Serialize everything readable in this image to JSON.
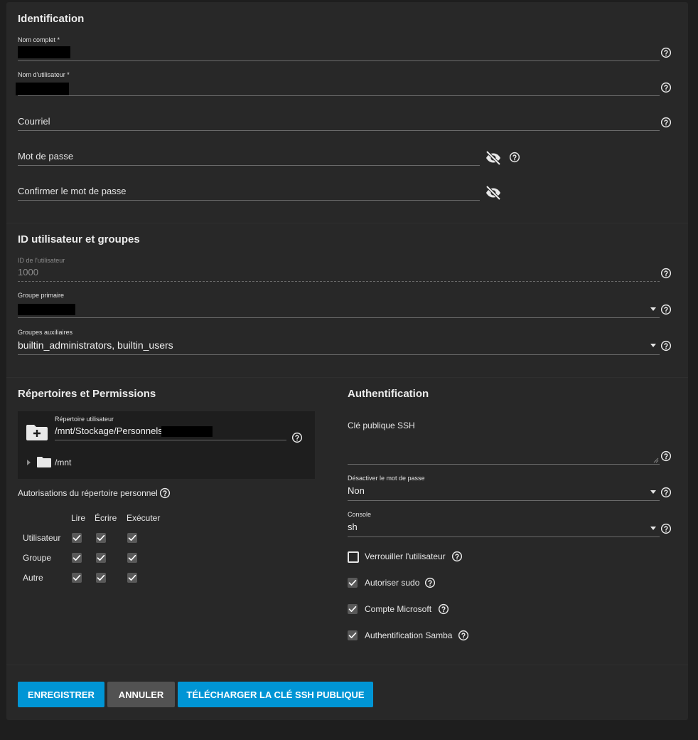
{
  "identification": {
    "title": "Identification",
    "full_name_label": "Nom complet *",
    "username_label": "Nom d'utilisateur *",
    "email_placeholder": "Courriel",
    "password_placeholder": "Mot de passe",
    "confirm_password_placeholder": "Confirmer le mot de passe"
  },
  "ids_groups": {
    "title": "ID utilisateur et groupes",
    "uid_label": "ID de l'utilisateur",
    "uid_value": "1000",
    "primary_group_label": "Groupe primaire",
    "aux_groups_label": "Groupes auxiliaires",
    "aux_groups_value": "builtin_administrators, builtin_users"
  },
  "directories": {
    "title": "Répertoires et Permissions",
    "home_dir_label": "Répertoire utilisateur",
    "home_dir_value": "/mnt/Stockage/Personnels/",
    "tree_node": "/mnt",
    "home_perms_label": "Autorisations du répertoire personnel",
    "perm_columns": [
      "Lire",
      "Écrire",
      "Exécuter"
    ],
    "perm_rows": [
      "Utilisateur",
      "Groupe",
      "Autre"
    ],
    "perm_checked": [
      [
        true,
        true,
        true
      ],
      [
        true,
        true,
        true
      ],
      [
        true,
        true,
        true
      ]
    ]
  },
  "authentication": {
    "title": "Authentification",
    "ssh_key_placeholder": "Clé publique SSH",
    "disable_password_label": "Désactiver le mot de passe",
    "disable_password_value": "Non",
    "shell_label": "Console",
    "shell_value": "sh",
    "checkboxes": [
      {
        "label": "Verrouiller l'utilisateur",
        "checked": false
      },
      {
        "label": "Autoriser sudo",
        "checked": true
      },
      {
        "label": "Compte Microsoft",
        "checked": true
      },
      {
        "label": "Authentification Samba",
        "checked": true
      }
    ]
  },
  "actions": {
    "save": "Enregistrer",
    "cancel": "Annuler",
    "download_ssh": "Télécharger la clé SSH publique"
  },
  "colors": {
    "background": "#1e1e1e",
    "card": "#282828",
    "primary_button": "#0095d5",
    "secondary_button": "#525252",
    "checkbox_fill": "#595959"
  },
  "icons": {
    "help": "help-circle-icon",
    "visibility": "eye-off-icon",
    "folder_add": "folder-plus-icon",
    "folder": "folder-icon",
    "expand": "caret-right-icon",
    "dropdown": "caret-down-icon",
    "check": "check-icon"
  }
}
